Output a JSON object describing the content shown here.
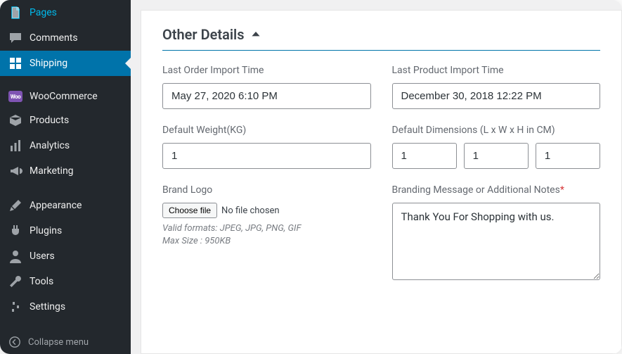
{
  "sidebar": {
    "items": [
      {
        "id": "pages",
        "label": "Pages",
        "icon": "pages"
      },
      {
        "id": "comments",
        "label": "Comments",
        "icon": "comment"
      },
      {
        "id": "shipping",
        "label": "Shipping",
        "icon": "grid",
        "active": true
      },
      {
        "id": "woocommerce",
        "label": "WooCommerce",
        "icon": "woo",
        "sepBefore": true
      },
      {
        "id": "products",
        "label": "Products",
        "icon": "box"
      },
      {
        "id": "analytics",
        "label": "Analytics",
        "icon": "bars"
      },
      {
        "id": "marketing",
        "label": "Marketing",
        "icon": "megaphone"
      },
      {
        "id": "appearance",
        "label": "Appearance",
        "icon": "brush",
        "sepBefore": true
      },
      {
        "id": "plugins",
        "label": "Plugins",
        "icon": "plug"
      },
      {
        "id": "users",
        "label": "Users",
        "icon": "user"
      },
      {
        "id": "tools",
        "label": "Tools",
        "icon": "wrench"
      },
      {
        "id": "settings",
        "label": "Settings",
        "icon": "sliders"
      }
    ],
    "collapse_label": "Collapse menu"
  },
  "section": {
    "title": "Other Details"
  },
  "fields": {
    "last_order_import": {
      "label": "Last Order Import Time",
      "value": "May 27, 2020 6:10 PM"
    },
    "last_product_import": {
      "label": "Last Product Import Time",
      "value": "December 30, 2018 12:22 PM"
    },
    "default_weight": {
      "label": "Default Weight(KG)",
      "value": "1"
    },
    "default_dimensions": {
      "label": "Default Dimensions (L x W x H in CM)",
      "length": "1",
      "width": "1",
      "height": "1"
    },
    "brand_logo": {
      "label": "Brand Logo",
      "button": "Choose file",
      "status": "No file chosen",
      "hint1": "Valid formats: JPEG, JPG, PNG, GIF",
      "hint2": "Max Size : 950KB"
    },
    "branding_message": {
      "label": "Branding Message or Additional Notes",
      "value": "Thank You For Shopping with us."
    }
  }
}
